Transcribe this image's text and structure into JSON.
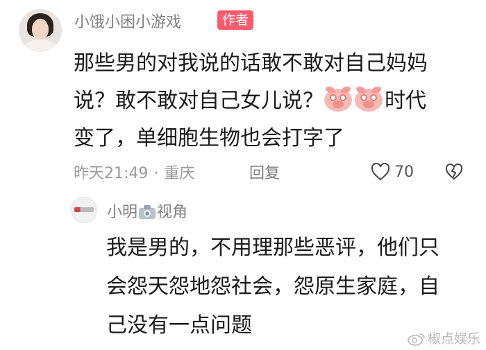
{
  "comment": {
    "username": "小饿小困小游戏",
    "author_badge": "作者",
    "lines": [
      "那些男的对我说的话敢不敢对自己妈妈",
      "说？敢不敢对自己女儿说？",
      "时代",
      "变了，单细胞生物也会打字了"
    ],
    "emoji_icons": [
      "pig-face-icon",
      "pig-face-icon"
    ],
    "time": "昨天21:49",
    "separator": "·",
    "location": "重庆",
    "reply_label": "回复",
    "like_count": "70"
  },
  "reply": {
    "username_prefix": "小明",
    "username_icon": "camera-icon",
    "username_suffix": "视角",
    "lines": [
      "我是男的，不用理那些恶评，他们只",
      "会怨天怨地怨社会，怨原生家庭，自",
      "己没有一点问题"
    ]
  },
  "watermark": {
    "icon": "weibo-icon",
    "text": "椒点娱乐"
  },
  "colors": {
    "badge": "#ff5a6e",
    "meta": "#9a9a9a",
    "text": "#1a1a1a"
  }
}
